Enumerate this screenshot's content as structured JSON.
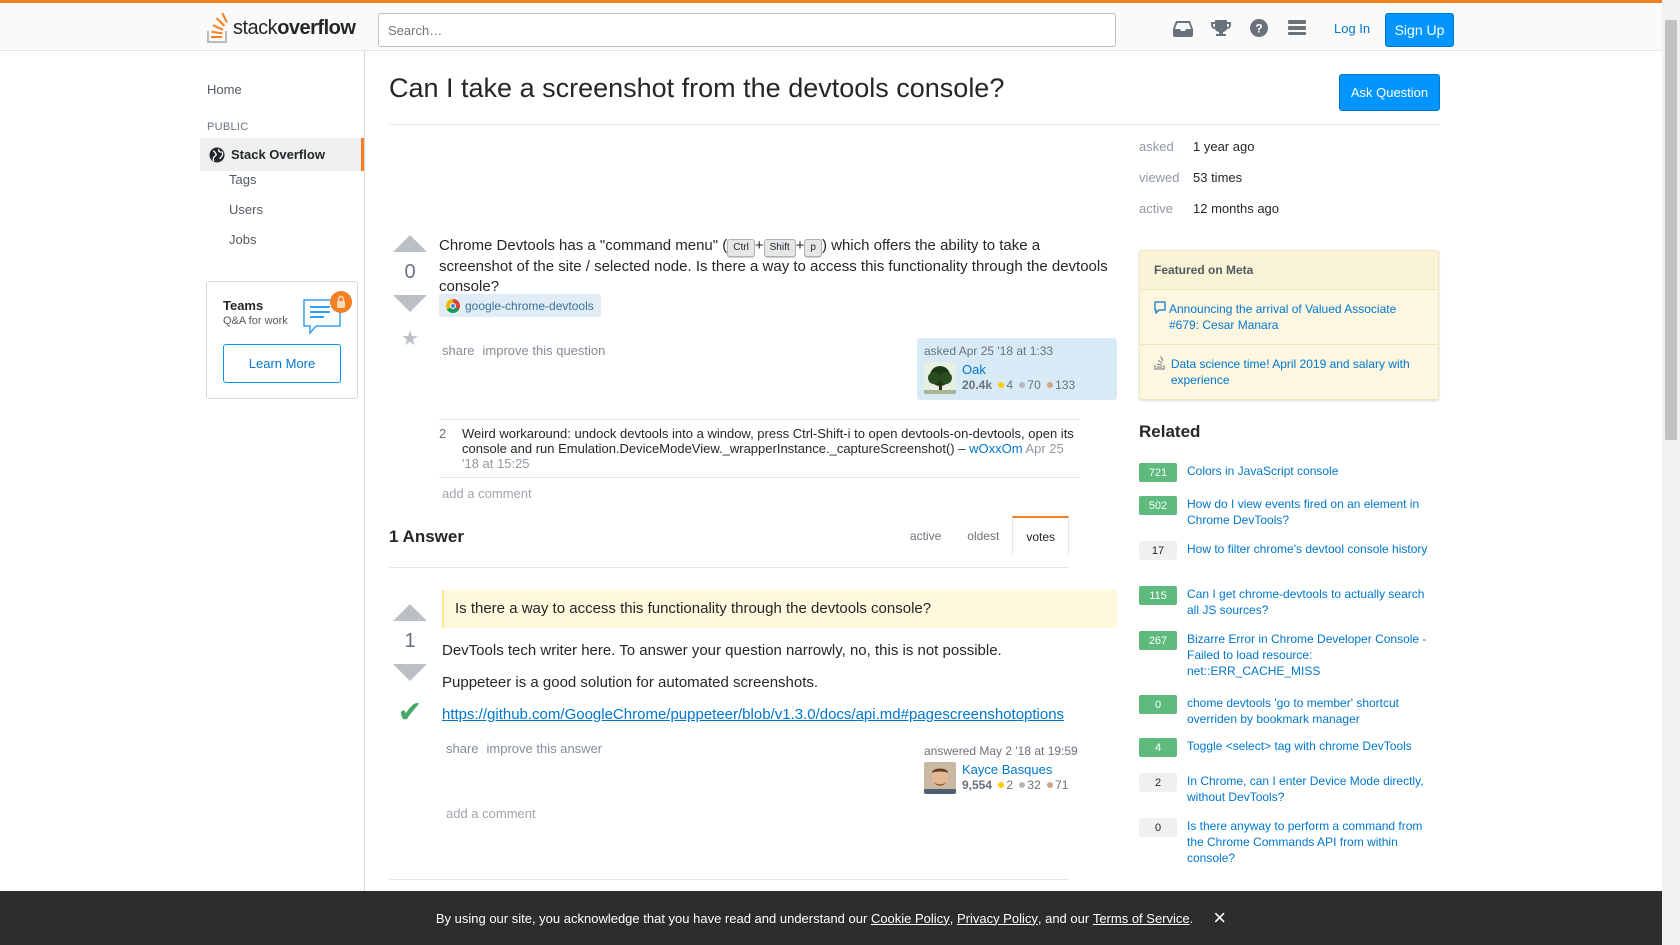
{
  "header": {
    "logo_text_light": "stack",
    "logo_text_bold": "overflow",
    "search_placeholder": "Search…",
    "icons": [
      "inbox-icon",
      "achievements-icon",
      "help-icon",
      "site-switcher-icon"
    ],
    "login_label": "Log In",
    "signup_label": "Sign Up",
    "accent_color": "#f48024"
  },
  "sidebar": {
    "home": "Home",
    "public_label": "PUBLIC",
    "current_site": "Stack Overflow",
    "items": [
      "Tags",
      "Users",
      "Jobs"
    ],
    "teams": {
      "title": "Teams",
      "subtitle": "Q&A for work",
      "button": "Learn More"
    }
  },
  "question": {
    "title": "Can I take a screenshot from the devtools console?",
    "ask_button": "Ask Question",
    "score": "0",
    "body_part1": "Chrome Devtools has a \"command menu\" (",
    "keys": [
      "Ctrl",
      "Shift",
      "p"
    ],
    "plus": "+",
    "body_part2": ") which offers the ability to take a screenshot of the site / selected node. Is there a way to access this functionality through the devtools console?",
    "tag": "google-chrome-devtools",
    "menu": [
      "share",
      "improve this question"
    ],
    "asked_time": "asked Apr 25 '18 at 1:33",
    "user": {
      "name": "Oak",
      "rep": "20.4k",
      "gold": "4",
      "silver": "70",
      "bronze": "133"
    },
    "comments": [
      {
        "score": "2",
        "text": "Weird workaround: undock devtools into a window, press Ctrl-Shift-i to open devtools-on-devtools, open its console and run Emulation.DeviceModeView._wrapperInstance._captureScreenshot() –",
        "user": "wOxxOm",
        "date": "Apr 25 '18 at 15:25"
      }
    ],
    "add_comment": "add a comment"
  },
  "answers": {
    "count_label": "1 Answer",
    "sort_tabs": [
      "active",
      "oldest",
      "votes"
    ],
    "active_sort": "votes",
    "items": [
      {
        "score": "1",
        "accepted": true,
        "quote": "Is there a way to access this functionality through the devtools console?",
        "p1": "DevTools tech writer here. To answer your question narrowly, no, this is not possible.",
        "p2": "Puppeteer is a good solution for automated screenshots.",
        "link": "https://github.com/GoogleChrome/puppeteer/blob/v1.3.0/docs/api.md#pagescreenshotoptions",
        "menu": [
          "share",
          "improve this answer"
        ],
        "answered_time": "answered May 2 '18 at 19:59",
        "user": {
          "name": "Kayce Basques",
          "rep": "9,554",
          "gold": "2",
          "silver": "32",
          "bronze": "71"
        },
        "add_comment": "add a comment"
      }
    ]
  },
  "stats": {
    "asked_label": "asked",
    "asked_value": "1 year ago",
    "viewed_label": "viewed",
    "viewed_value": "53 times",
    "active_label": "active",
    "active_value": "12 months ago"
  },
  "featured_meta": {
    "title": "Featured on Meta",
    "items": [
      "Announcing the arrival of Valued Associate #679: Cesar Manara",
      "Data science time! April 2019 and salary with experience"
    ]
  },
  "related": {
    "title": "Related",
    "items": [
      {
        "score": "721",
        "answered": true,
        "title": "Colors in JavaScript console"
      },
      {
        "score": "502",
        "answered": true,
        "title": "How do I view events fired on an element in Chrome DevTools?"
      },
      {
        "score": "17",
        "answered": false,
        "title": "How to filter chrome's devtool console history"
      },
      {
        "score": "115",
        "answered": true,
        "title": "Can I get chrome-devtools to actually search all JS sources?"
      },
      {
        "score": "267",
        "answered": true,
        "title": "Bizarre Error in Chrome Developer Console - Failed to load resource: net::ERR_CACHE_MISS"
      },
      {
        "score": "0",
        "answered": true,
        "title": "chome devtools 'go to member' shortcut overriden by bookmark manager"
      },
      {
        "score": "4",
        "answered": true,
        "title": "Toggle <select> tag with chrome DevTools"
      },
      {
        "score": "2",
        "answered": false,
        "title": "In Chrome, can I enter Device Mode directly, without DevTools?"
      },
      {
        "score": "0",
        "answered": false,
        "title": "Is there anyway to perform a command from the Chrome Commands API from within console?"
      }
    ]
  },
  "cookie": {
    "text1": "By using our site, you acknowledge that you have read and understand our",
    "cookie_policy": "Cookie Policy",
    "sep1": ",",
    "privacy_policy": "Privacy Policy",
    "text2": ", and our",
    "terms": "Terms of Service",
    "end": ".",
    "close_icon": "×"
  }
}
